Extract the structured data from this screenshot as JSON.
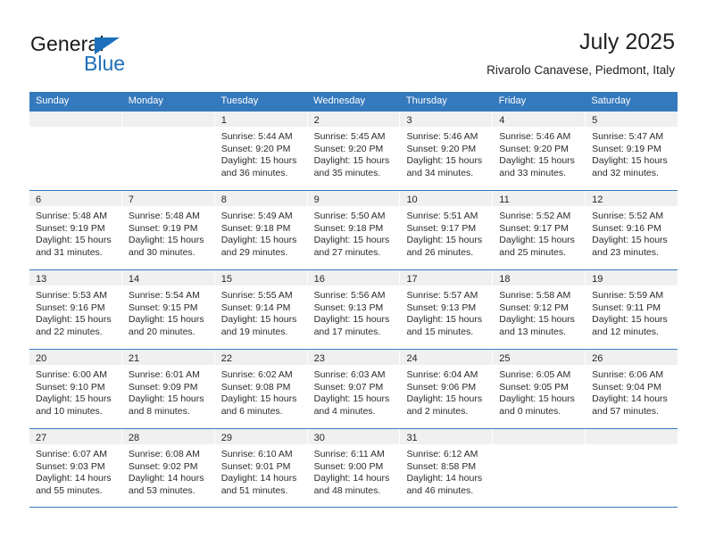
{
  "brand": {
    "name_part1": "General",
    "name_part2": "Blue",
    "accent_color": "#1c6fba"
  },
  "header": {
    "title": "July 2025",
    "subtitle": "Rivarolo Canavese, Piedmont, Italy"
  },
  "calendar": {
    "header_color": "#3579bd",
    "day_band_color": "#f0f0f0",
    "weekdays": [
      "Sunday",
      "Monday",
      "Tuesday",
      "Wednesday",
      "Thursday",
      "Friday",
      "Saturday"
    ],
    "weeks": [
      [
        {
          "day": "",
          "sunrise": "",
          "sunset": "",
          "daylight1": "",
          "daylight2": ""
        },
        {
          "day": "",
          "sunrise": "",
          "sunset": "",
          "daylight1": "",
          "daylight2": ""
        },
        {
          "day": "1",
          "sunrise": "Sunrise: 5:44 AM",
          "sunset": "Sunset: 9:20 PM",
          "daylight1": "Daylight: 15 hours",
          "daylight2": "and 36 minutes."
        },
        {
          "day": "2",
          "sunrise": "Sunrise: 5:45 AM",
          "sunset": "Sunset: 9:20 PM",
          "daylight1": "Daylight: 15 hours",
          "daylight2": "and 35 minutes."
        },
        {
          "day": "3",
          "sunrise": "Sunrise: 5:46 AM",
          "sunset": "Sunset: 9:20 PM",
          "daylight1": "Daylight: 15 hours",
          "daylight2": "and 34 minutes."
        },
        {
          "day": "4",
          "sunrise": "Sunrise: 5:46 AM",
          "sunset": "Sunset: 9:20 PM",
          "daylight1": "Daylight: 15 hours",
          "daylight2": "and 33 minutes."
        },
        {
          "day": "5",
          "sunrise": "Sunrise: 5:47 AM",
          "sunset": "Sunset: 9:19 PM",
          "daylight1": "Daylight: 15 hours",
          "daylight2": "and 32 minutes."
        }
      ],
      [
        {
          "day": "6",
          "sunrise": "Sunrise: 5:48 AM",
          "sunset": "Sunset: 9:19 PM",
          "daylight1": "Daylight: 15 hours",
          "daylight2": "and 31 minutes."
        },
        {
          "day": "7",
          "sunrise": "Sunrise: 5:48 AM",
          "sunset": "Sunset: 9:19 PM",
          "daylight1": "Daylight: 15 hours",
          "daylight2": "and 30 minutes."
        },
        {
          "day": "8",
          "sunrise": "Sunrise: 5:49 AM",
          "sunset": "Sunset: 9:18 PM",
          "daylight1": "Daylight: 15 hours",
          "daylight2": "and 29 minutes."
        },
        {
          "day": "9",
          "sunrise": "Sunrise: 5:50 AM",
          "sunset": "Sunset: 9:18 PM",
          "daylight1": "Daylight: 15 hours",
          "daylight2": "and 27 minutes."
        },
        {
          "day": "10",
          "sunrise": "Sunrise: 5:51 AM",
          "sunset": "Sunset: 9:17 PM",
          "daylight1": "Daylight: 15 hours",
          "daylight2": "and 26 minutes."
        },
        {
          "day": "11",
          "sunrise": "Sunrise: 5:52 AM",
          "sunset": "Sunset: 9:17 PM",
          "daylight1": "Daylight: 15 hours",
          "daylight2": "and 25 minutes."
        },
        {
          "day": "12",
          "sunrise": "Sunrise: 5:52 AM",
          "sunset": "Sunset: 9:16 PM",
          "daylight1": "Daylight: 15 hours",
          "daylight2": "and 23 minutes."
        }
      ],
      [
        {
          "day": "13",
          "sunrise": "Sunrise: 5:53 AM",
          "sunset": "Sunset: 9:16 PM",
          "daylight1": "Daylight: 15 hours",
          "daylight2": "and 22 minutes."
        },
        {
          "day": "14",
          "sunrise": "Sunrise: 5:54 AM",
          "sunset": "Sunset: 9:15 PM",
          "daylight1": "Daylight: 15 hours",
          "daylight2": "and 20 minutes."
        },
        {
          "day": "15",
          "sunrise": "Sunrise: 5:55 AM",
          "sunset": "Sunset: 9:14 PM",
          "daylight1": "Daylight: 15 hours",
          "daylight2": "and 19 minutes."
        },
        {
          "day": "16",
          "sunrise": "Sunrise: 5:56 AM",
          "sunset": "Sunset: 9:13 PM",
          "daylight1": "Daylight: 15 hours",
          "daylight2": "and 17 minutes."
        },
        {
          "day": "17",
          "sunrise": "Sunrise: 5:57 AM",
          "sunset": "Sunset: 9:13 PM",
          "daylight1": "Daylight: 15 hours",
          "daylight2": "and 15 minutes."
        },
        {
          "day": "18",
          "sunrise": "Sunrise: 5:58 AM",
          "sunset": "Sunset: 9:12 PM",
          "daylight1": "Daylight: 15 hours",
          "daylight2": "and 13 minutes."
        },
        {
          "day": "19",
          "sunrise": "Sunrise: 5:59 AM",
          "sunset": "Sunset: 9:11 PM",
          "daylight1": "Daylight: 15 hours",
          "daylight2": "and 12 minutes."
        }
      ],
      [
        {
          "day": "20",
          "sunrise": "Sunrise: 6:00 AM",
          "sunset": "Sunset: 9:10 PM",
          "daylight1": "Daylight: 15 hours",
          "daylight2": "and 10 minutes."
        },
        {
          "day": "21",
          "sunrise": "Sunrise: 6:01 AM",
          "sunset": "Sunset: 9:09 PM",
          "daylight1": "Daylight: 15 hours",
          "daylight2": "and 8 minutes."
        },
        {
          "day": "22",
          "sunrise": "Sunrise: 6:02 AM",
          "sunset": "Sunset: 9:08 PM",
          "daylight1": "Daylight: 15 hours",
          "daylight2": "and 6 minutes."
        },
        {
          "day": "23",
          "sunrise": "Sunrise: 6:03 AM",
          "sunset": "Sunset: 9:07 PM",
          "daylight1": "Daylight: 15 hours",
          "daylight2": "and 4 minutes."
        },
        {
          "day": "24",
          "sunrise": "Sunrise: 6:04 AM",
          "sunset": "Sunset: 9:06 PM",
          "daylight1": "Daylight: 15 hours",
          "daylight2": "and 2 minutes."
        },
        {
          "day": "25",
          "sunrise": "Sunrise: 6:05 AM",
          "sunset": "Sunset: 9:05 PM",
          "daylight1": "Daylight: 15 hours",
          "daylight2": "and 0 minutes."
        },
        {
          "day": "26",
          "sunrise": "Sunrise: 6:06 AM",
          "sunset": "Sunset: 9:04 PM",
          "daylight1": "Daylight: 14 hours",
          "daylight2": "and 57 minutes."
        }
      ],
      [
        {
          "day": "27",
          "sunrise": "Sunrise: 6:07 AM",
          "sunset": "Sunset: 9:03 PM",
          "daylight1": "Daylight: 14 hours",
          "daylight2": "and 55 minutes."
        },
        {
          "day": "28",
          "sunrise": "Sunrise: 6:08 AM",
          "sunset": "Sunset: 9:02 PM",
          "daylight1": "Daylight: 14 hours",
          "daylight2": "and 53 minutes."
        },
        {
          "day": "29",
          "sunrise": "Sunrise: 6:10 AM",
          "sunset": "Sunset: 9:01 PM",
          "daylight1": "Daylight: 14 hours",
          "daylight2": "and 51 minutes."
        },
        {
          "day": "30",
          "sunrise": "Sunrise: 6:11 AM",
          "sunset": "Sunset: 9:00 PM",
          "daylight1": "Daylight: 14 hours",
          "daylight2": "and 48 minutes."
        },
        {
          "day": "31",
          "sunrise": "Sunrise: 6:12 AM",
          "sunset": "Sunset: 8:58 PM",
          "daylight1": "Daylight: 14 hours",
          "daylight2": "and 46 minutes."
        },
        {
          "day": "",
          "sunrise": "",
          "sunset": "",
          "daylight1": "",
          "daylight2": ""
        },
        {
          "day": "",
          "sunrise": "",
          "sunset": "",
          "daylight1": "",
          "daylight2": ""
        }
      ]
    ]
  }
}
